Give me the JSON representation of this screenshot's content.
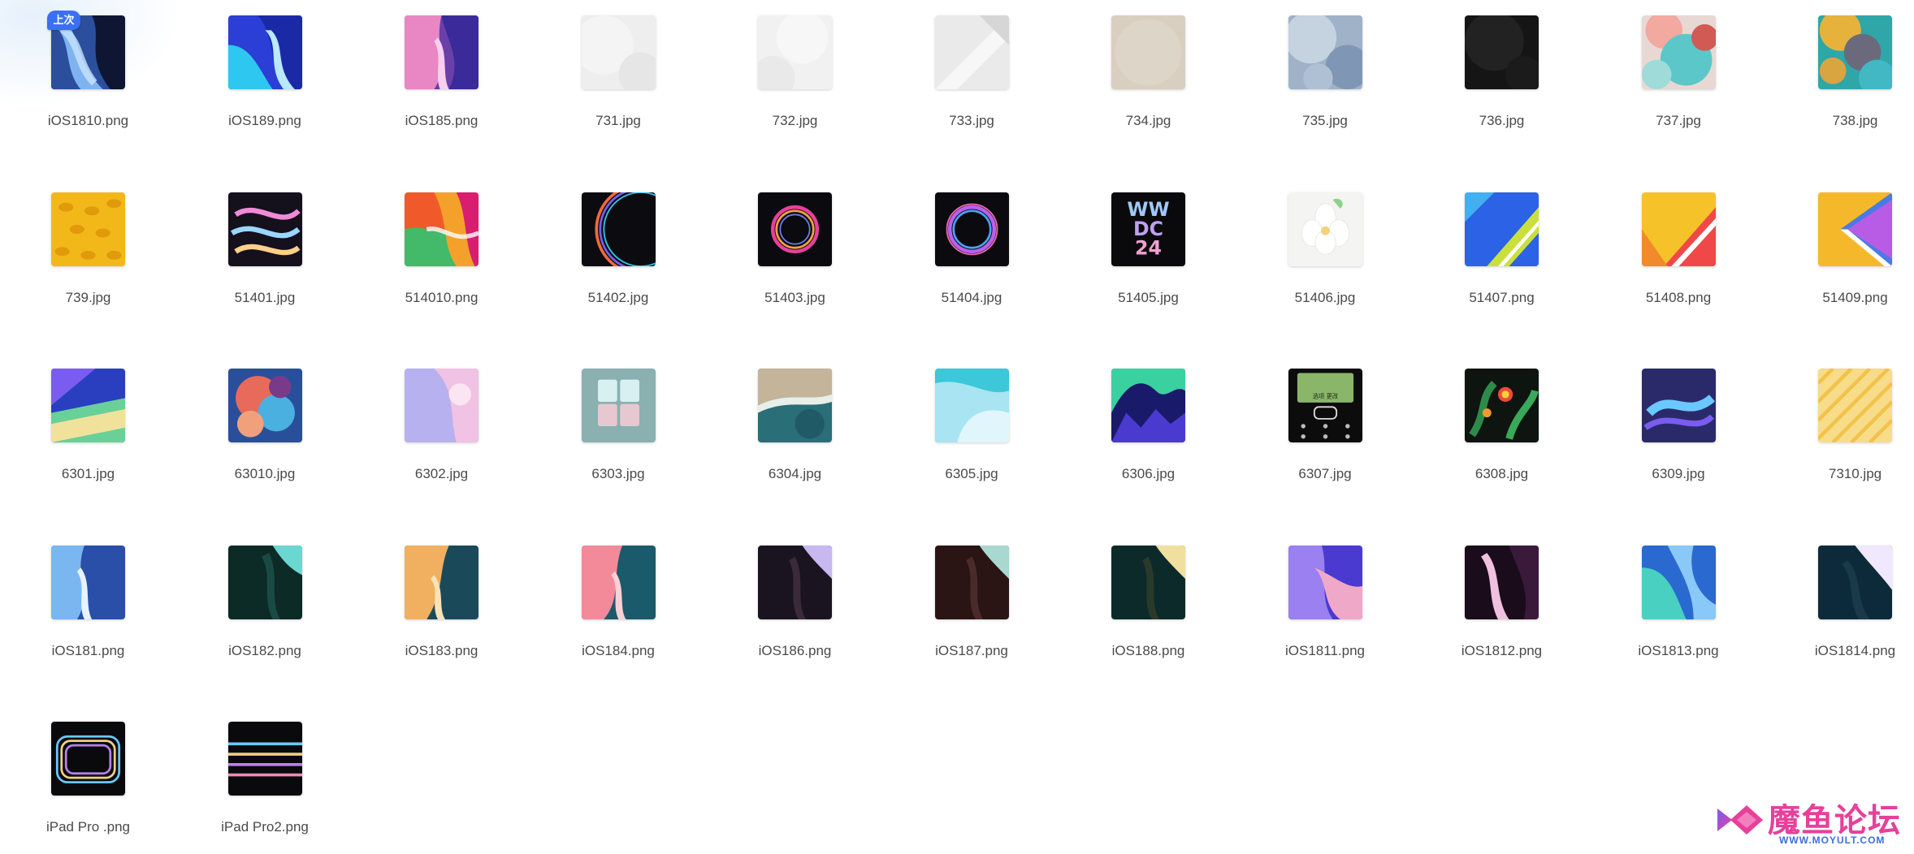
{
  "badge": {
    "label": "上次"
  },
  "files": [
    {
      "name": "iOS1810.png",
      "thumb": "ios-dark-blue",
      "badge": true
    },
    {
      "name": "iOS189.png",
      "thumb": "ios-blue-cyan"
    },
    {
      "name": "iOS185.png",
      "thumb": "ios-pink-purple"
    },
    {
      "name": "731.jpg",
      "thumb": "paper-white"
    },
    {
      "name": "732.jpg",
      "thumb": "paper-white-2"
    },
    {
      "name": "733.jpg",
      "thumb": "paper-fold"
    },
    {
      "name": "734.jpg",
      "thumb": "paper-beige"
    },
    {
      "name": "735.jpg",
      "thumb": "blue-texture"
    },
    {
      "name": "736.jpg",
      "thumb": "black-texture"
    },
    {
      "name": "737.jpg",
      "thumb": "aqua-red"
    },
    {
      "name": "738.jpg",
      "thumb": "yellow-teal"
    },
    {
      "name": "739.jpg",
      "thumb": "yellow-pattern"
    },
    {
      "name": "51401.jpg",
      "thumb": "neon-ribbons"
    },
    {
      "name": "514010.png",
      "thumb": "orange-green-wave"
    },
    {
      "name": "51402.jpg",
      "thumb": "dark-arc"
    },
    {
      "name": "51403.jpg",
      "thumb": "dark-ring-magenta"
    },
    {
      "name": "51404.jpg",
      "thumb": "dark-ring-violet"
    },
    {
      "name": "51405.jpg",
      "thumb": "wwdc",
      "text": "WW DC 24"
    },
    {
      "name": "51406.jpg",
      "thumb": "white-flower"
    },
    {
      "name": "51407.png",
      "thumb": "blue-yellow-stripe"
    },
    {
      "name": "51408.png",
      "thumb": "yellow-red-stripe"
    },
    {
      "name": "51409.png",
      "thumb": "yellow-blue-chevron"
    },
    {
      "name": "6301.jpg",
      "thumb": "blue-green-rays"
    },
    {
      "name": "63010.jpg",
      "thumb": "smoke-color"
    },
    {
      "name": "6302.jpg",
      "thumb": "lavender-pink"
    },
    {
      "name": "6303.jpg",
      "thumb": "teal-window"
    },
    {
      "name": "6304.jpg",
      "thumb": "aerial-sea"
    },
    {
      "name": "6305.jpg",
      "thumb": "cyan-glass"
    },
    {
      "name": "6306.jpg",
      "thumb": "aurora"
    },
    {
      "name": "6307.jpg",
      "thumb": "feature-phone",
      "text": "选项   更改"
    },
    {
      "name": "6308.jpg",
      "thumb": "tropical-parrot"
    },
    {
      "name": "6309.jpg",
      "thumb": "purple-smoke"
    },
    {
      "name": "7310.jpg",
      "thumb": "yellow-diagonal"
    },
    {
      "name": "iOS181.png",
      "thumb": "ios-181"
    },
    {
      "name": "iOS182.png",
      "thumb": "ios-182"
    },
    {
      "name": "iOS183.png",
      "thumb": "ios-183"
    },
    {
      "name": "iOS184.png",
      "thumb": "ios-184"
    },
    {
      "name": "iOS186.png",
      "thumb": "ios-186"
    },
    {
      "name": "iOS187.png",
      "thumb": "ios-187"
    },
    {
      "name": "iOS188.png",
      "thumb": "ios-188"
    },
    {
      "name": "iOS1811.png",
      "thumb": "ios-1811"
    },
    {
      "name": "iOS1812.png",
      "thumb": "ios-1812"
    },
    {
      "name": "iOS1813.png",
      "thumb": "ios-1813"
    },
    {
      "name": "iOS1814.png",
      "thumb": "ios-1814"
    },
    {
      "name": "iPad Pro .png",
      "thumb": "ipad-pro-1"
    },
    {
      "name": "iPad Pro2.png",
      "thumb": "ipad-pro-2"
    }
  ],
  "watermark": {
    "title": "魔鱼论坛",
    "url": "WWW.MOYULT.COM"
  },
  "colors": {
    "label_text": "#4a4a4a",
    "badge_blue": "#3b6ff5",
    "watermark_pink": "#e6409b",
    "watermark_blue": "#3b6fd9"
  }
}
